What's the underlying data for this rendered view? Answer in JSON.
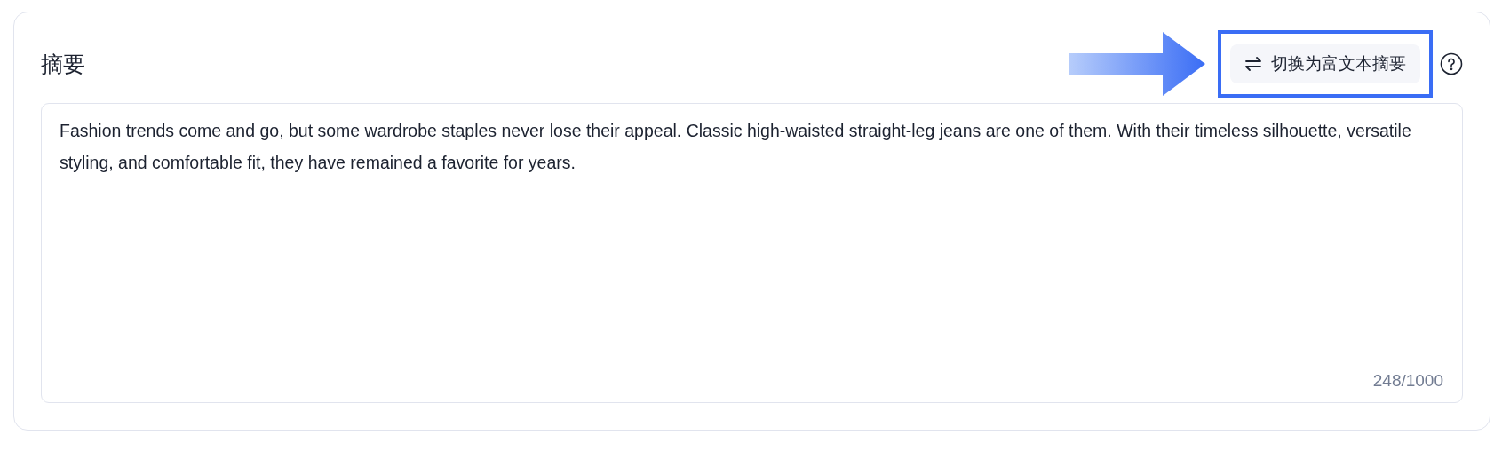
{
  "section": {
    "title": "摘要",
    "switch_button": {
      "label": "切换为富文本摘要",
      "highlighted": true
    },
    "summary": {
      "value": "Fashion trends come and go, but some wardrobe staples never lose their appeal. Classic high-waisted straight-leg jeans are one of them. With their timeless silhouette, versatile styling, and comfortable fit, they have remained a favorite for years.",
      "counter": "248/1000"
    }
  }
}
